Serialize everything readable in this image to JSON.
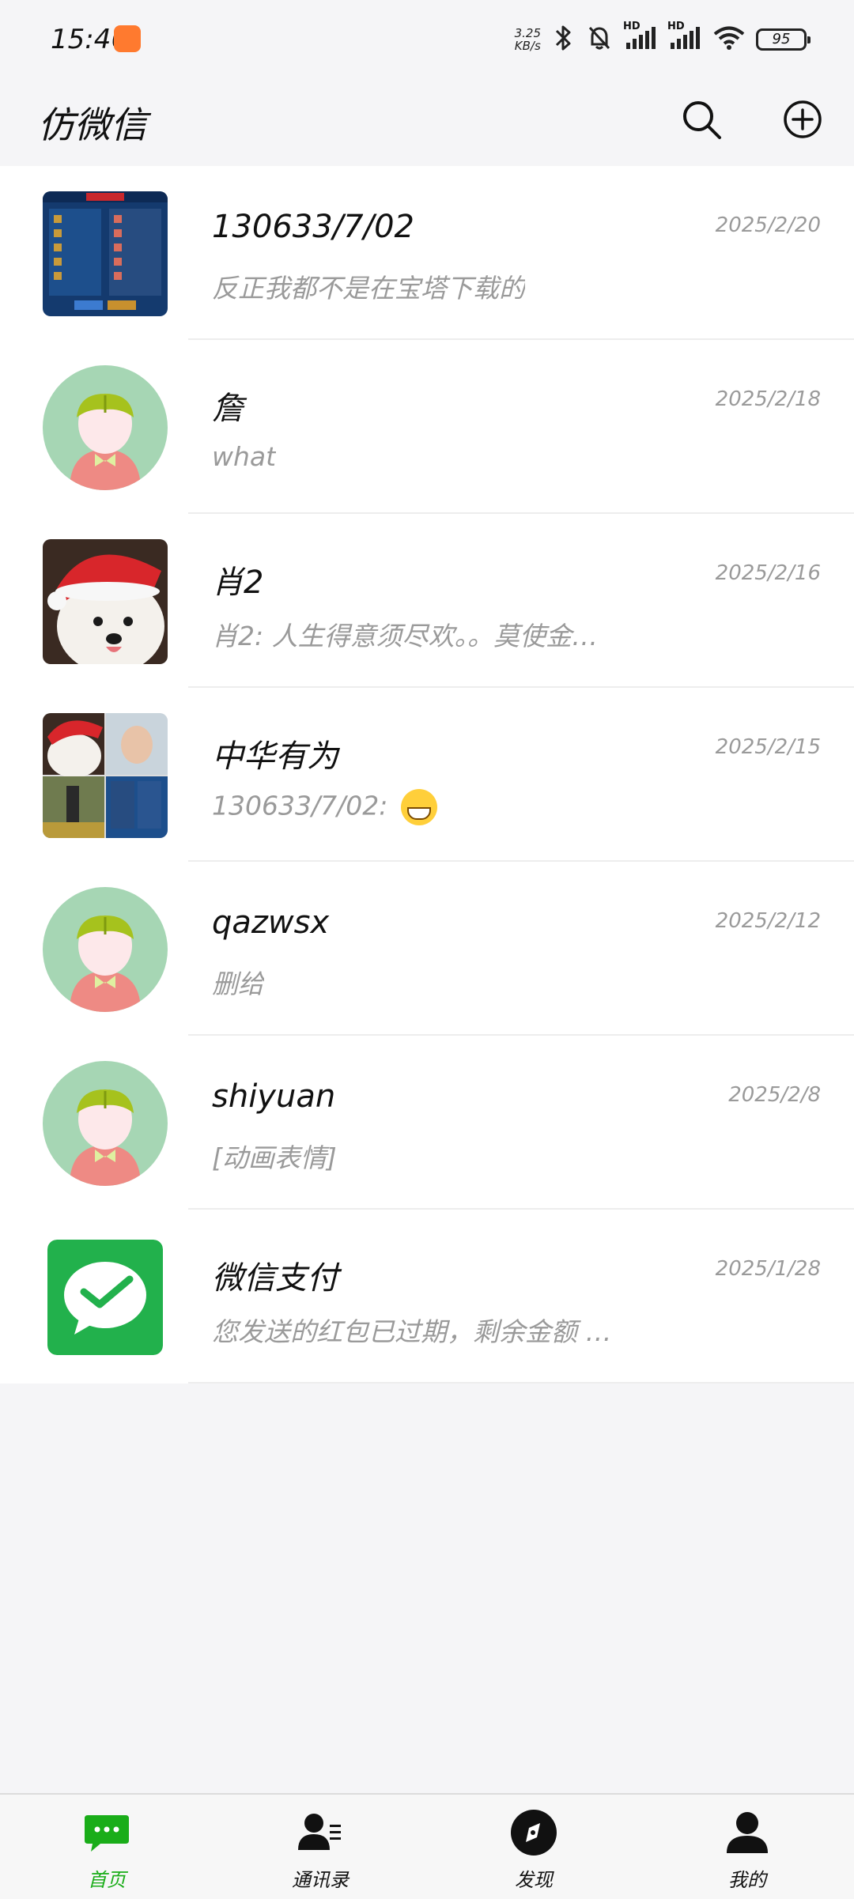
{
  "status_bar": {
    "time": "15:46",
    "net_speed_value": "3.25",
    "net_speed_unit": "KB/s",
    "signal_label_1": "HD",
    "signal_label_2": "HD",
    "battery": "95"
  },
  "header": {
    "title": "仿微信",
    "search_icon": "search-icon",
    "add_icon": "add-circle-icon"
  },
  "chats": [
    {
      "name": "130633/7/02",
      "time": "2025/2/20",
      "message": "反正我都不是在宝塔下载的",
      "avatar": "game-screenshot"
    },
    {
      "name": "詹",
      "time": "2025/2/18",
      "message": "what",
      "avatar": "default-cartoon"
    },
    {
      "name": "肖2",
      "time": "2025/2/16",
      "message": "肖2: 人生得意须尽欢。。莫使金…",
      "avatar": "dog-with-santa-hat"
    },
    {
      "name": "中华有为",
      "time": "2025/2/15",
      "message": "130633/7/02: ",
      "avatar": "group-collage",
      "emoji": "grinning-face-emoji"
    },
    {
      "name": "qazwsx",
      "time": "2025/2/12",
      "message": "删给",
      "avatar": "default-cartoon"
    },
    {
      "name": "shiyuan",
      "time": "2025/2/8",
      "message": "[动画表情]",
      "avatar": "default-cartoon"
    },
    {
      "name": "微信支付",
      "time": "2025/1/28",
      "message": "您发送的红包已过期，剩余金额 …",
      "avatar": "wechat-pay-logo"
    }
  ],
  "bottom_nav": [
    {
      "label": "首页",
      "icon": "chat-bubble-icon",
      "active": true
    },
    {
      "label": "通讯录",
      "icon": "contacts-icon",
      "active": false
    },
    {
      "label": "发现",
      "icon": "compass-icon",
      "active": false
    },
    {
      "label": "我的",
      "icon": "person-icon",
      "active": false
    }
  ],
  "colors": {
    "accent": "#1aad19",
    "background": "#f5f5f7",
    "secondary_text": "#9a9a9a"
  }
}
